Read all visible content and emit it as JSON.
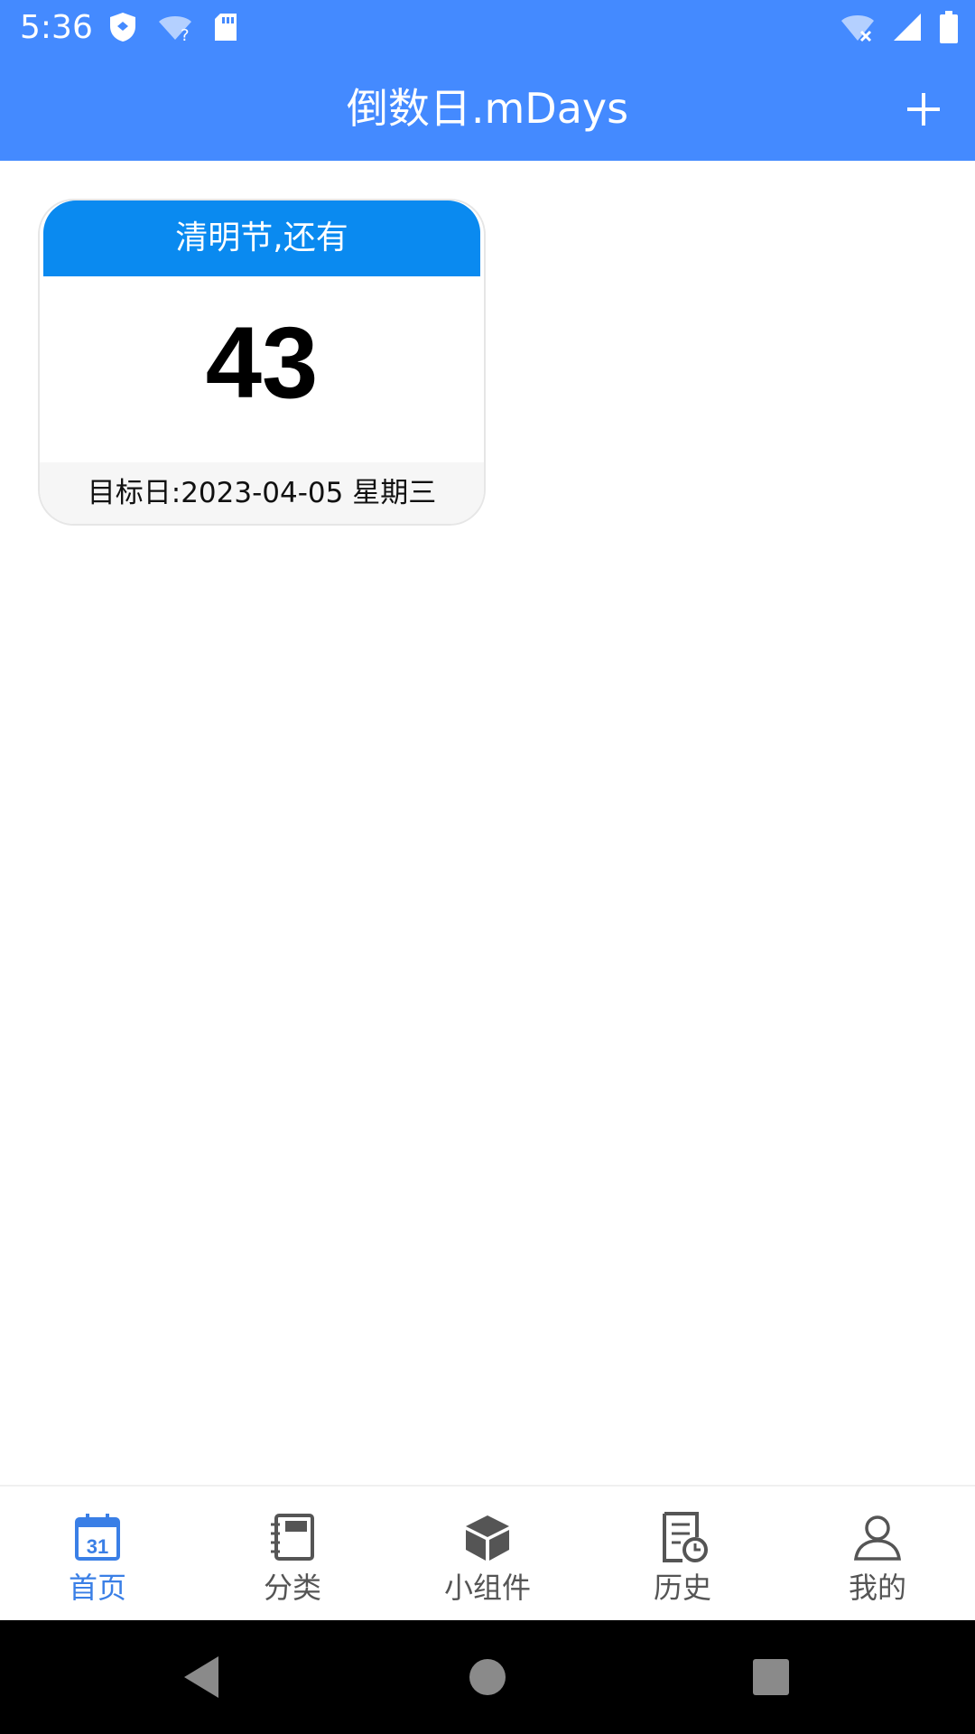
{
  "status_bar": {
    "time": "5:36",
    "icons": [
      "shield-icon",
      "wifi-question-icon",
      "sd-card-icon",
      "wifi-x-icon",
      "signal-icon",
      "battery-icon"
    ]
  },
  "app_bar": {
    "title": "倒数日.mDays",
    "add_icon": "plus-icon"
  },
  "countdown_card": {
    "header": "清明节,还有",
    "days": "43",
    "footer": "目标日:2023-04-05 星期三"
  },
  "bottom_nav": {
    "items": [
      {
        "label": "首页",
        "icon": "calendar-31-icon",
        "active": true
      },
      {
        "label": "分类",
        "icon": "notebook-icon",
        "active": false
      },
      {
        "label": "小组件",
        "icon": "cube-icon",
        "active": false
      },
      {
        "label": "历史",
        "icon": "history-document-icon",
        "active": false
      },
      {
        "label": "我的",
        "icon": "user-icon",
        "active": false
      }
    ]
  },
  "colors": {
    "app_bar": "#448AFF",
    "card_header": "#0A8AF0",
    "nav_active": "#3A7FE6",
    "nav_inactive": "#555555"
  }
}
